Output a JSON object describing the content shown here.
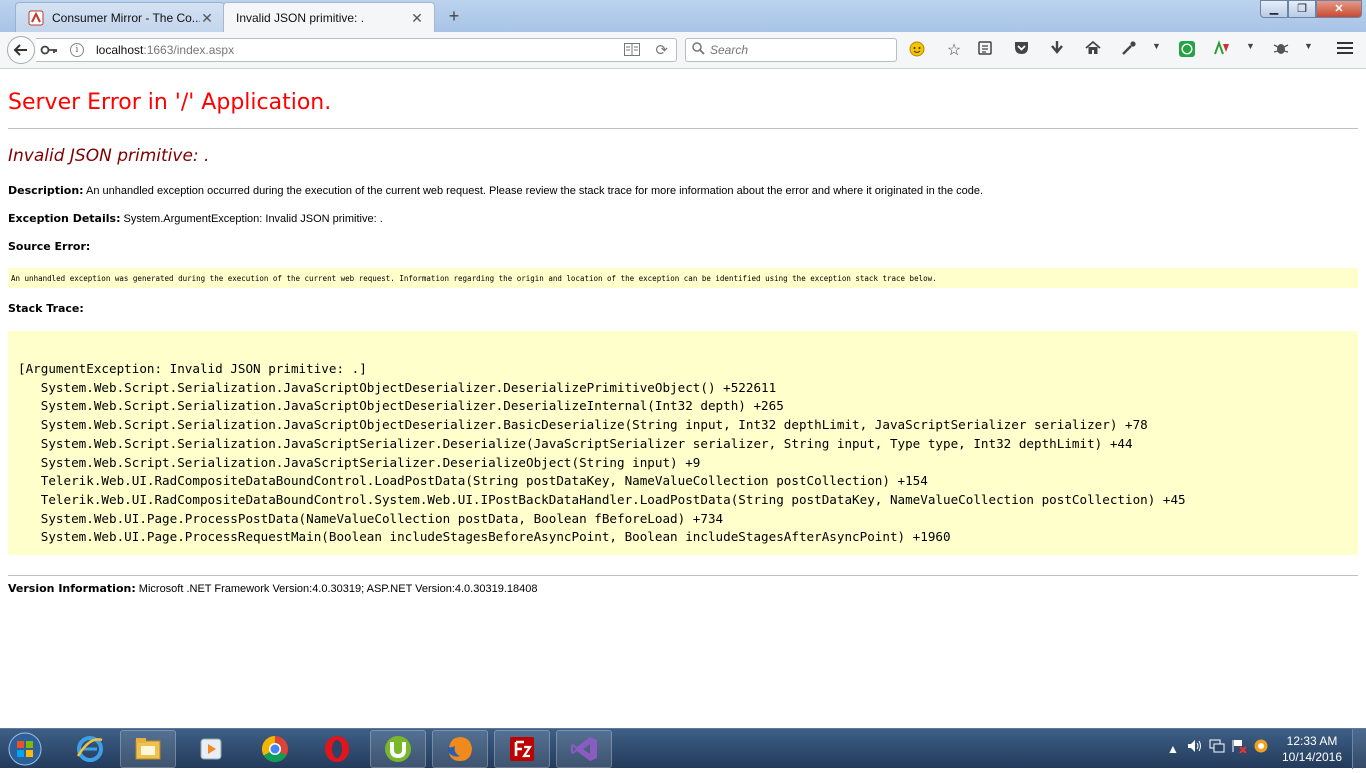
{
  "browser": {
    "tabs": [
      {
        "label": "Consumer Mirror - The Co...",
        "active": false,
        "icon": "consumer-mirror-favicon"
      },
      {
        "label": "Invalid JSON primitive: .",
        "active": true,
        "icon": "none"
      }
    ],
    "newtab_label": "+",
    "url": {
      "host": "localhost",
      "rest": ":1663/index.aspx"
    },
    "search_placeholder": "Search",
    "window_buttons": {
      "minimize": "▁",
      "maximize": "❐",
      "close": "✕"
    }
  },
  "page": {
    "title": "Server Error in '/' Application.",
    "error_message": "Invalid JSON primitive: .",
    "description_label": "Description:",
    "description_text": "An unhandled exception occurred during the execution of the current web request. Please review the stack trace for more information about the error and where it originated in the code.",
    "exception_label": "Exception Details:",
    "exception_text": "System.ArgumentException: Invalid JSON primitive: .",
    "source_error_label": "Source Error:",
    "source_error_text": "An unhandled exception was generated during the execution of the current web request. Information regarding the origin and location of the exception can be identified using the exception stack trace below.",
    "stack_trace_label": "Stack Trace:",
    "stack_trace_text": "[ArgumentException: Invalid JSON primitive: .]\n   System.Web.Script.Serialization.JavaScriptObjectDeserializer.DeserializePrimitiveObject() +522611\n   System.Web.Script.Serialization.JavaScriptObjectDeserializer.DeserializeInternal(Int32 depth) +265\n   System.Web.Script.Serialization.JavaScriptObjectDeserializer.BasicDeserialize(String input, Int32 depthLimit, JavaScriptSerializer serializer) +78\n   System.Web.Script.Serialization.JavaScriptSerializer.Deserialize(JavaScriptSerializer serializer, String input, Type type, Int32 depthLimit) +44\n   System.Web.Script.Serialization.JavaScriptSerializer.DeserializeObject(String input) +9\n   Telerik.Web.UI.RadCompositeDataBoundControl.LoadPostData(String postDataKey, NameValueCollection postCollection) +154\n   Telerik.Web.UI.RadCompositeDataBoundControl.System.Web.UI.IPostBackDataHandler.LoadPostData(String postDataKey, NameValueCollection postCollection) +45\n   System.Web.UI.Page.ProcessPostData(NameValueCollection postData, Boolean fBeforeLoad) +734\n   System.Web.UI.Page.ProcessRequestMain(Boolean includeStagesBeforeAsyncPoint, Boolean includeStagesAfterAsyncPoint) +1960",
    "version_label": "Version Information:",
    "version_text": "Microsoft .NET Framework Version:4.0.30319; ASP.NET Version:4.0.30319.18408"
  },
  "taskbar": {
    "apps": [
      "internet-explorer-icon",
      "file-explorer-icon",
      "media-player-icon",
      "chrome-icon",
      "opera-icon",
      "utorrent-icon",
      "firefox-icon",
      "filezilla-icon",
      "visual-studio-icon"
    ],
    "clock_time": "12:33 AM",
    "clock_date": "10/14/2016"
  },
  "colors": {
    "error_title": "#ff0000",
    "error_message": "#800000",
    "code_background": "#ffffcc",
    "taskbar": "#2b4467"
  }
}
